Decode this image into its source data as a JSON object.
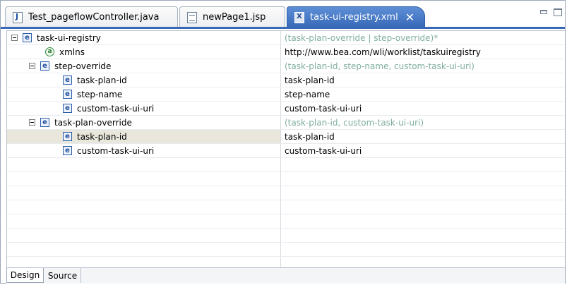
{
  "tabs": [
    {
      "label": "Test_pageflowController.java",
      "icon": "java-file-icon",
      "active": false
    },
    {
      "label": "newPage1.jsp",
      "icon": "jsp-file-icon",
      "active": true
    },
    {
      "label": "task-ui-registry.xml",
      "icon": "xml-file-icon",
      "active": true,
      "close": "✕"
    }
  ],
  "colors": {
    "active_tab": "#3769b8",
    "hint_text": "#7fae9e",
    "selected_row": "#e9e7dc"
  },
  "tree": {
    "rows": [
      {
        "name": "task-ui-registry",
        "value": "(task-plan-override | step-override)*",
        "kind": "element",
        "toggle": true
      },
      {
        "name": "xmlns",
        "value": "http://www.bea.com/wli/worklist/taskuiregistry",
        "kind": "attribute"
      },
      {
        "name": "step-override",
        "value": "(task-plan-id, step-name, custom-task-ui-uri)",
        "kind": "element",
        "toggle": true
      },
      {
        "name": "task-plan-id",
        "value": "task-plan-id",
        "kind": "element"
      },
      {
        "name": "step-name",
        "value": "step-name",
        "kind": "element"
      },
      {
        "name": "custom-task-ui-uri",
        "value": "custom-task-ui-uri",
        "kind": "element"
      },
      {
        "name": "task-plan-override",
        "value": "(task-plan-id, custom-task-ui-uri)",
        "kind": "element",
        "toggle": true
      },
      {
        "name": "task-plan-id",
        "value": "task-plan-id",
        "kind": "element",
        "selected": true
      },
      {
        "name": "custom-task-ui-uri",
        "value": "custom-task-ui-uri",
        "kind": "element"
      }
    ],
    "element_glyph": "e",
    "attribute_glyph": "a"
  },
  "bottom_tabs": [
    {
      "label": "Design",
      "active": true
    },
    {
      "label": "Source",
      "active": false
    }
  ]
}
